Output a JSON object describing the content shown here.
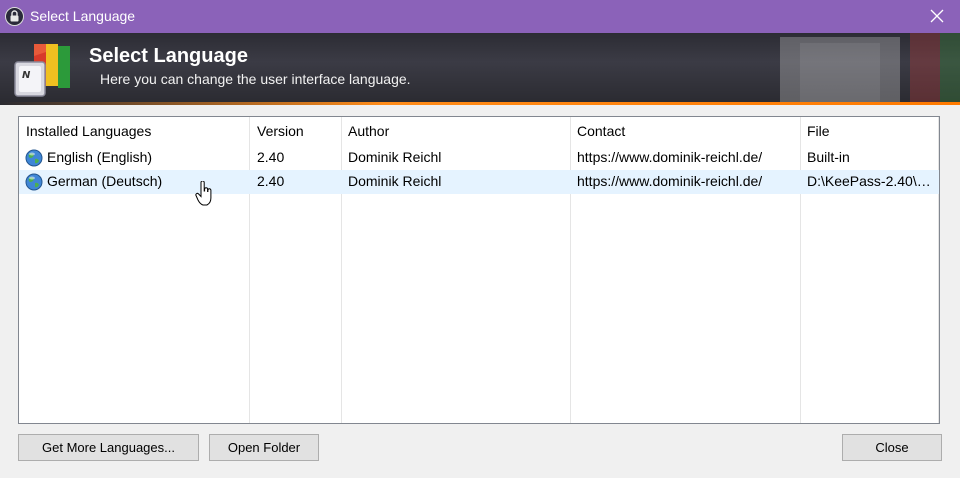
{
  "window": {
    "title": "Select Language"
  },
  "banner": {
    "title": "Select Language",
    "subtitle": "Here you can change the user interface language."
  },
  "list": {
    "columns": [
      "Installed Languages",
      "Version",
      "Author",
      "Contact",
      "File"
    ],
    "rows": [
      {
        "language": "English (English)",
        "version": "2.40",
        "author": "Dominik Reichl",
        "contact": "https://www.dominik-reichl.de/",
        "file": "Built-in",
        "selected": false
      },
      {
        "language": "German (Deutsch)",
        "version": "2.40",
        "author": "Dominik Reichl",
        "contact": "https://www.dominik-reichl.de/",
        "file": "D:\\KeePass-2.40\\…",
        "selected": true
      }
    ]
  },
  "buttons": {
    "get_more": "Get More Languages...",
    "open_folder": "Open Folder",
    "close": "Close"
  },
  "colors": {
    "titlebar": "#8b62b9",
    "selection": "#e5f3ff",
    "banner_accent": "#ff8c1a"
  }
}
